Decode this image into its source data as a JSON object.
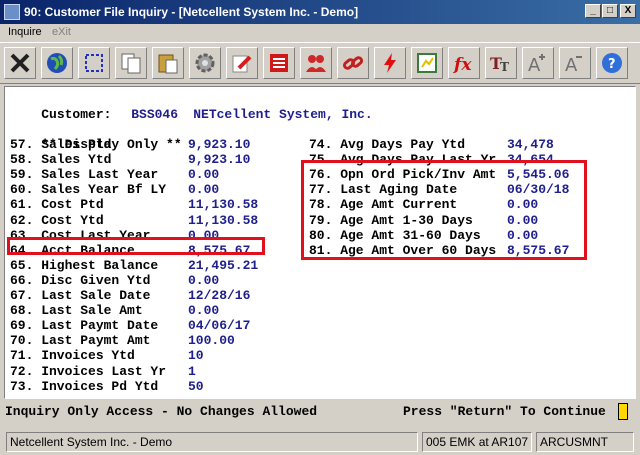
{
  "window": {
    "title": "90: Customer File Inquiry - [Netcellent System Inc. - Demo]",
    "min_label": "_",
    "max_label": "□",
    "close_label": "X"
  },
  "menu": {
    "inquire": "Inquire",
    "exit": "eXit"
  },
  "toolbar_icons": [
    "close-icon",
    "globe-icon",
    "select-icon",
    "copy-icon",
    "paste-icon",
    "settings-icon",
    "edit-icon",
    "list-icon",
    "users-icon",
    "link-icon",
    "lightning-icon",
    "chart-icon",
    "function-icon",
    "font-size-icon",
    "font-increase-icon",
    "font-decrease-icon",
    "help-icon"
  ],
  "customer": {
    "label": "Customer:",
    "code": "BSS046",
    "name": "NETcellent System, Inc."
  },
  "display_only": "** Display Only **",
  "left_fields": [
    {
      "label": "57. Sales Ptd",
      "value": "9,923.10"
    },
    {
      "label": "58. Sales Ytd",
      "value": "9,923.10"
    },
    {
      "label": "59. Sales Last Year",
      "value": "0.00"
    },
    {
      "label": "60. Sales Year Bf LY",
      "value": "0.00"
    },
    {
      "label": "61. Cost Ptd",
      "value": "11,130.58"
    },
    {
      "label": "62. Cost Ytd",
      "value": "11,130.58"
    },
    {
      "label": "63. Cost Last Year",
      "value": "0.00"
    },
    {
      "label": "64. Acct Balance",
      "value": "8,575.67"
    },
    {
      "label": "65. Highest Balance",
      "value": "21,495.21"
    },
    {
      "label": "66. Disc Given Ytd",
      "value": "0.00"
    },
    {
      "label": "67. Last Sale Date",
      "value": "12/28/16"
    },
    {
      "label": "68. Last Sale Amt",
      "value": "0.00"
    },
    {
      "label": "69. Last Paymt Date",
      "value": "04/06/17"
    },
    {
      "label": "70. Last Paymt Amt",
      "value": "100.00"
    },
    {
      "label": "71. Invoices Ytd",
      "value": "10"
    },
    {
      "label": "72. Invoices Last Yr",
      "value": "1"
    },
    {
      "label": "73. Invoices Pd Ytd",
      "value": "50"
    }
  ],
  "right_fields": [
    {
      "label": "74. Avg Days Pay Ytd",
      "value": "34,478"
    },
    {
      "label": "75. Avg Days Pay Last Yr",
      "value": "34,654"
    },
    {
      "label": "76. Opn Ord Pick/Inv Amt",
      "value": "5,545.06"
    },
    {
      "label": "77. Last Aging Date",
      "value": "06/30/18"
    },
    {
      "label": "78. Age Amt Current",
      "value": "0.00"
    },
    {
      "label": "79. Age Amt 1-30 Days",
      "value": "0.00"
    },
    {
      "label": "80. Age Amt 31-60 Days",
      "value": "0.00"
    },
    {
      "label": "81. Age Amt Over 60 Days",
      "value": "8,575.67"
    }
  ],
  "status": {
    "access": "Inquiry Only Access - No Changes Allowed",
    "prompt": "Press \"Return\" To Continue",
    "company": "Netcellent System Inc. - Demo",
    "terminal": "005 EMK at AR107",
    "program": "ARCUSMNT"
  },
  "colors": {
    "value_text": "#1e1e8c",
    "highlight_box": "#e0101c",
    "title_bar": "#0a246a"
  }
}
